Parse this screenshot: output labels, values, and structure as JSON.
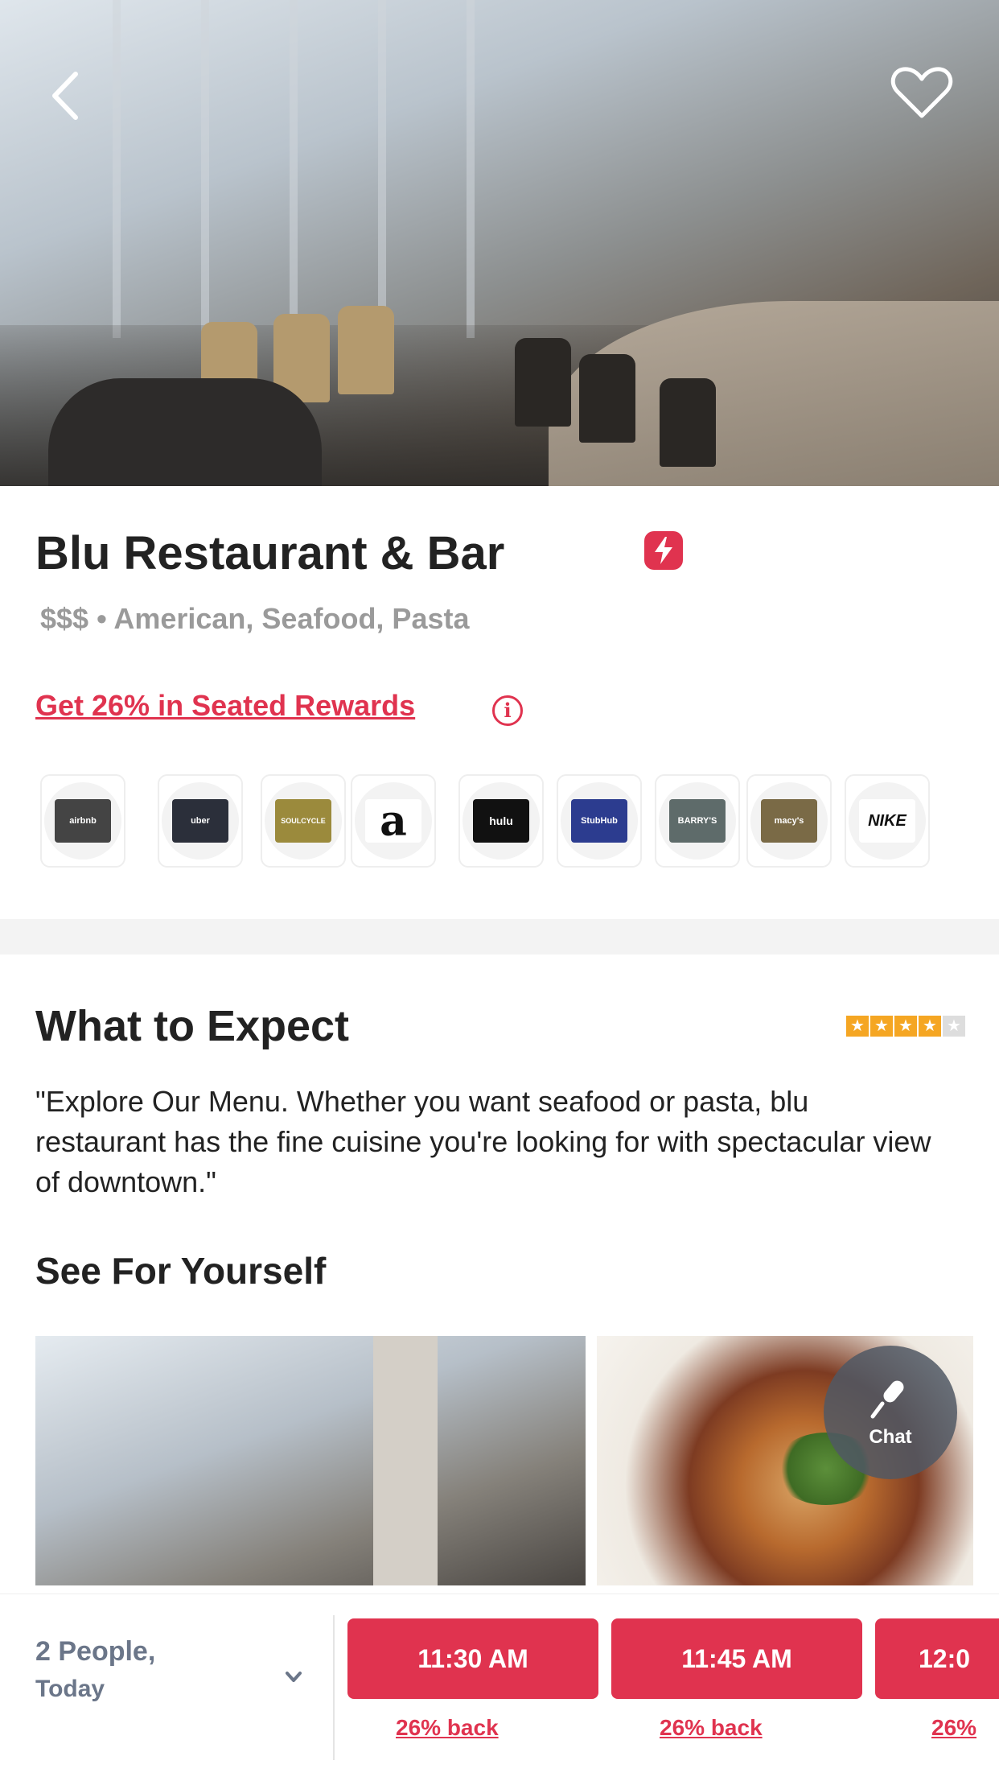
{
  "hero": {
    "back_icon": "chevron-left-icon",
    "favorite_icon": "heart-icon"
  },
  "restaurant": {
    "name": "Blu Restaurant & Bar",
    "badge_icon": "lightning-bolt-icon",
    "subtitle": "$$$ • American, Seafood, Pasta",
    "rewards_text": "Get 26% in Seated Rewards",
    "info_icon": "info-icon"
  },
  "partners": [
    {
      "name": "airbnb",
      "color": "#444444"
    },
    {
      "name": "uber",
      "color": "#2b2f3a"
    },
    {
      "name": "SOULCYCLE",
      "color": "#9b8a3c"
    },
    {
      "name": "a",
      "color": "#ffffff"
    },
    {
      "name": "hulu",
      "color": "#111111"
    },
    {
      "name": "StubHub",
      "color": "#2c3c8f"
    },
    {
      "name": "BARRY'S",
      "color": "#5e6b6a"
    },
    {
      "name": "macy's",
      "color": "#7a6a46"
    },
    {
      "name": "NIKE",
      "color": "#ffffff"
    }
  ],
  "expect": {
    "title": "What to Expect",
    "rating_count": "",
    "stars": 4,
    "description": "\"Explore Our Menu. Whether you want seafood or pasta, blu restaurant has the fine cuisine you're looking for with spectacular view of downtown.\""
  },
  "gallery": {
    "title": "See For Yourself"
  },
  "chat": {
    "icon": "microphone-icon",
    "label": "Chat"
  },
  "booking": {
    "party": "2 People,",
    "day": "Today",
    "dropdown_icon": "chevron-down-icon",
    "slots": [
      {
        "time": "11:30 AM",
        "back": "26% back"
      },
      {
        "time": "11:45 AM",
        "back": "26% back"
      },
      {
        "time": "12:0",
        "back": "26%"
      }
    ]
  },
  "colors": {
    "accent": "#e0334f",
    "muted": "#6b7689"
  }
}
